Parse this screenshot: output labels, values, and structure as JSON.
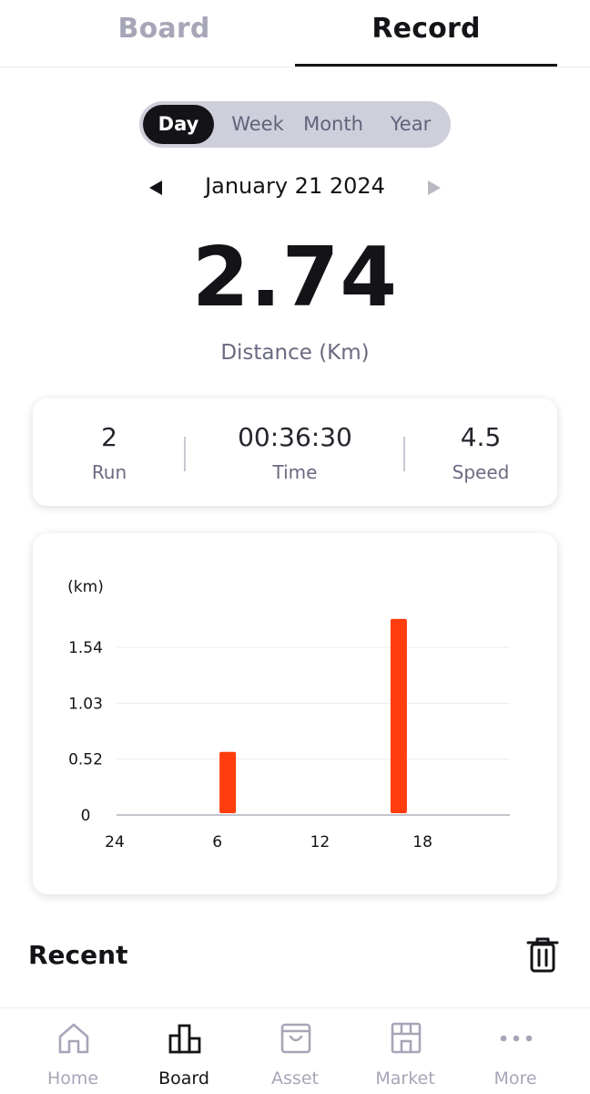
{
  "top_tabs": {
    "board": "Board",
    "record": "Record",
    "active": "record"
  },
  "period": {
    "options": [
      "Day",
      "Week",
      "Month",
      "Year"
    ],
    "selected": "Day"
  },
  "date_nav": {
    "label": "January 21 2024"
  },
  "summary": {
    "distance_value": "2.74",
    "distance_label": "Distance (Km)"
  },
  "stats": {
    "run": {
      "value": "2",
      "label": "Run"
    },
    "time": {
      "value": "00:36:30",
      "label": "Time"
    },
    "speed": {
      "value": "4.5",
      "label": "Speed"
    }
  },
  "chart_data": {
    "type": "bar",
    "ylabel": "(km)",
    "y_ticks": [
      "0",
      "0.52",
      "1.03",
      "1.54"
    ],
    "y_tick_values": [
      0,
      0.52,
      1.03,
      1.54
    ],
    "x_ticks": [
      "24",
      "6",
      "12",
      "18"
    ],
    "x_tick_hours": [
      0,
      6,
      12,
      18
    ],
    "x_range": [
      0,
      23
    ],
    "ylim": [
      0,
      1.54
    ],
    "bars": [
      {
        "hour": 6.5,
        "value": 0.58
      },
      {
        "hour": 16.5,
        "value": 1.8
      }
    ],
    "grid": true,
    "colors": {
      "bar": "#ff3d0d",
      "grid": "#ececf0",
      "axis": "#c5c5cc"
    }
  },
  "recent": {
    "title": "Recent"
  },
  "bottom_nav": {
    "active": "Board",
    "items": [
      {
        "label": "Home",
        "icon": "home-icon"
      },
      {
        "label": "Board",
        "icon": "bar-chart-icon"
      },
      {
        "label": "Asset",
        "icon": "bag-icon"
      },
      {
        "label": "Market",
        "icon": "store-icon"
      },
      {
        "label": "More",
        "icon": "more-icon"
      }
    ]
  },
  "colors": {
    "accent": "#ff3d0d",
    "dark": "#141418",
    "muted": "#a6a6b8"
  }
}
